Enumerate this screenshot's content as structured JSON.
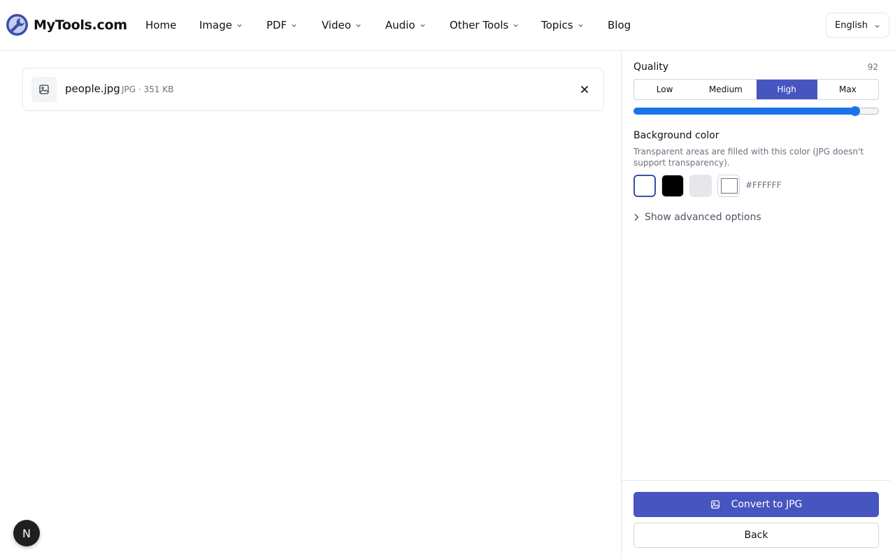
{
  "header": {
    "brand": "MyTools.com",
    "nav": [
      {
        "label": "Home"
      },
      {
        "label": "Image"
      },
      {
        "label": "PDF"
      },
      {
        "label": "Video"
      },
      {
        "label": "Audio"
      },
      {
        "label": "Other Tools"
      },
      {
        "label": "Topics"
      },
      {
        "label": "Blog"
      }
    ],
    "language": "English"
  },
  "file": {
    "name": "people.jpg",
    "meta": "JPG · 351 KB"
  },
  "settings": {
    "quality_label": "Quality",
    "quality_value": 92,
    "quality_presets": [
      "Low",
      "Medium",
      "High",
      "Max"
    ],
    "quality_selected": "High",
    "background_label": "Background color",
    "background_desc": "Transparent areas are filled with this color (JPG doesn't support transparency).",
    "swatches": [
      "#FFFFFF",
      "#000000",
      "#E5E7EB"
    ],
    "selected_color": "#FFFFFF",
    "advanced_label": "Show advanced options"
  },
  "actions": {
    "convert_label": "Convert to JPG",
    "back_label": "Back"
  },
  "badge": "N",
  "colors": {
    "accent": "#4655C0",
    "slider": "#1A73E8"
  }
}
